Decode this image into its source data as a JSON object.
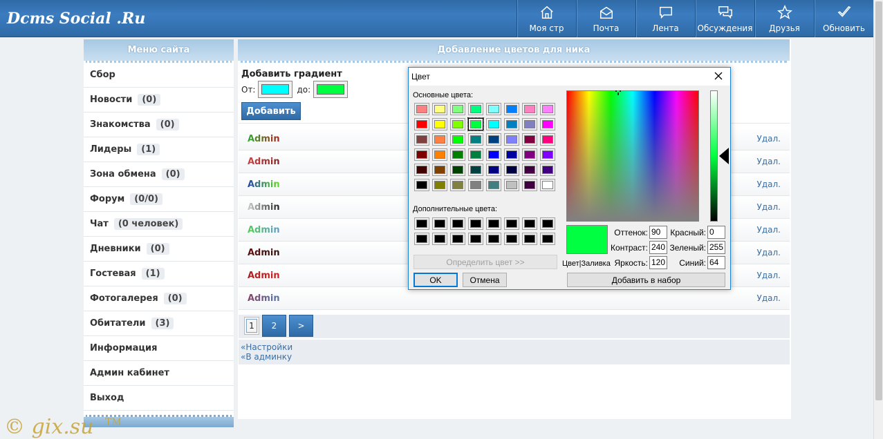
{
  "header": {
    "logo": "Dcms Social .Ru",
    "nav": [
      {
        "label": "Моя стр",
        "icon": "home-icon"
      },
      {
        "label": "Почта",
        "icon": "mail-icon"
      },
      {
        "label": "Лента",
        "icon": "chat-icon"
      },
      {
        "label": "Обсуждения",
        "icon": "discussions-icon"
      },
      {
        "label": "Друзья",
        "icon": "star-icon"
      },
      {
        "label": "Обновить",
        "icon": "check-icon"
      }
    ]
  },
  "sidebar": {
    "title": "Меню сайта",
    "items": [
      {
        "label": "Сбор",
        "count": ""
      },
      {
        "label": "Новости",
        "count": "(0)"
      },
      {
        "label": "Знакомства",
        "count": "(0)"
      },
      {
        "label": "Лидеры",
        "count": "(1)"
      },
      {
        "label": "Зона обмена",
        "count": "(0)"
      },
      {
        "label": "Форум",
        "count": "(0/0)"
      },
      {
        "label": "Чат",
        "count": "(0 человек)"
      },
      {
        "label": "Дневники",
        "count": "(0)"
      },
      {
        "label": "Гостевая",
        "count": "(1)"
      },
      {
        "label": "Фотогалерея",
        "count": "(0)"
      },
      {
        "label": "Обитатели",
        "count": "(3)"
      },
      {
        "label": "Информация",
        "count": ""
      },
      {
        "label": "Админ кабинет",
        "count": ""
      },
      {
        "label": "Выход",
        "count": ""
      }
    ]
  },
  "main": {
    "title": "Добавление цветов для ника",
    "form": {
      "heading": "Добавить градиент",
      "from_label": "От:",
      "to_label": "до:",
      "from_color": "#00ffff",
      "to_color": "#00ff40",
      "add_button": "Добавить"
    },
    "rows": [
      {
        "nick": "Admin",
        "from": "#33aa33",
        "to": "#aa2222",
        "delete": "Удал."
      },
      {
        "nick": "Admin",
        "from": "#cc4444",
        "to": "#882222",
        "delete": "Удал."
      },
      {
        "nick": "Admin",
        "from": "#2244aa",
        "to": "#66dd22",
        "delete": "Удал."
      },
      {
        "nick": "Admin",
        "from": "#cccccc",
        "to": "#222222",
        "delete": "Удал."
      },
      {
        "nick": "Admin",
        "from": "#55cc55",
        "to": "#6699cc",
        "delete": "Удал."
      },
      {
        "nick": "Admin",
        "from": "#661111",
        "to": "#331111",
        "delete": "Удал."
      },
      {
        "nick": "Admin",
        "from": "#aa2222",
        "to": "#cc2222",
        "delete": "Удал."
      },
      {
        "nick": "Admin",
        "from": "#884466",
        "to": "#5577aa",
        "delete": "Удал."
      }
    ],
    "pager": {
      "current": "1",
      "next_page": "2",
      "next_arrow": ">"
    },
    "links": [
      "«Настройки",
      "«В админку"
    ]
  },
  "dialog": {
    "title": "Цвет",
    "basic_label": "Основные цвета:",
    "custom_label": "Дополнительные цвета:",
    "define_button": "Определить цвет >>",
    "ok": "OK",
    "cancel": "Отмена",
    "add_to_set": "Добавить в набор",
    "preview_label": "Цвет|Заливка",
    "preview_color": "#00ff40",
    "hue_label": "Оттенок:",
    "hue": "90",
    "sat_label": "Контраст:",
    "sat": "240",
    "lum_label": "Яркость:",
    "lum": "120",
    "red_label": "Красный:",
    "red": "0",
    "green_label": "Зеленый:",
    "green": "255",
    "blue_label": "Синий:",
    "blue": "64",
    "basic_colors": [
      "#ff8080",
      "#ffff80",
      "#80ff80",
      "#00ff80",
      "#80ffff",
      "#0080ff",
      "#ff80c0",
      "#ff80ff",
      "#ff0000",
      "#ffff00",
      "#80ff00",
      "#00ff40",
      "#00ffff",
      "#0080c0",
      "#8080c0",
      "#ff00ff",
      "#804040",
      "#ff8040",
      "#00ff00",
      "#008080",
      "#004080",
      "#8080ff",
      "#800040",
      "#ff0080",
      "#800000",
      "#ff8000",
      "#008000",
      "#008040",
      "#0000ff",
      "#0000a0",
      "#800080",
      "#8000ff",
      "#400000",
      "#804000",
      "#004000",
      "#004040",
      "#000080",
      "#000040",
      "#400040",
      "#400080",
      "#000000",
      "#808000",
      "#808040",
      "#808080",
      "#408080",
      "#c0c0c0",
      "#400040",
      "#ffffff"
    ],
    "custom_colors": [
      "#000000",
      "#000000",
      "#000000",
      "#000000",
      "#000000",
      "#000000",
      "#000000",
      "#000000",
      "#000000",
      "#000000",
      "#000000",
      "#000000",
      "#000000",
      "#000000",
      "#000000",
      "#000000"
    ]
  },
  "watermark": "© gix.su™"
}
